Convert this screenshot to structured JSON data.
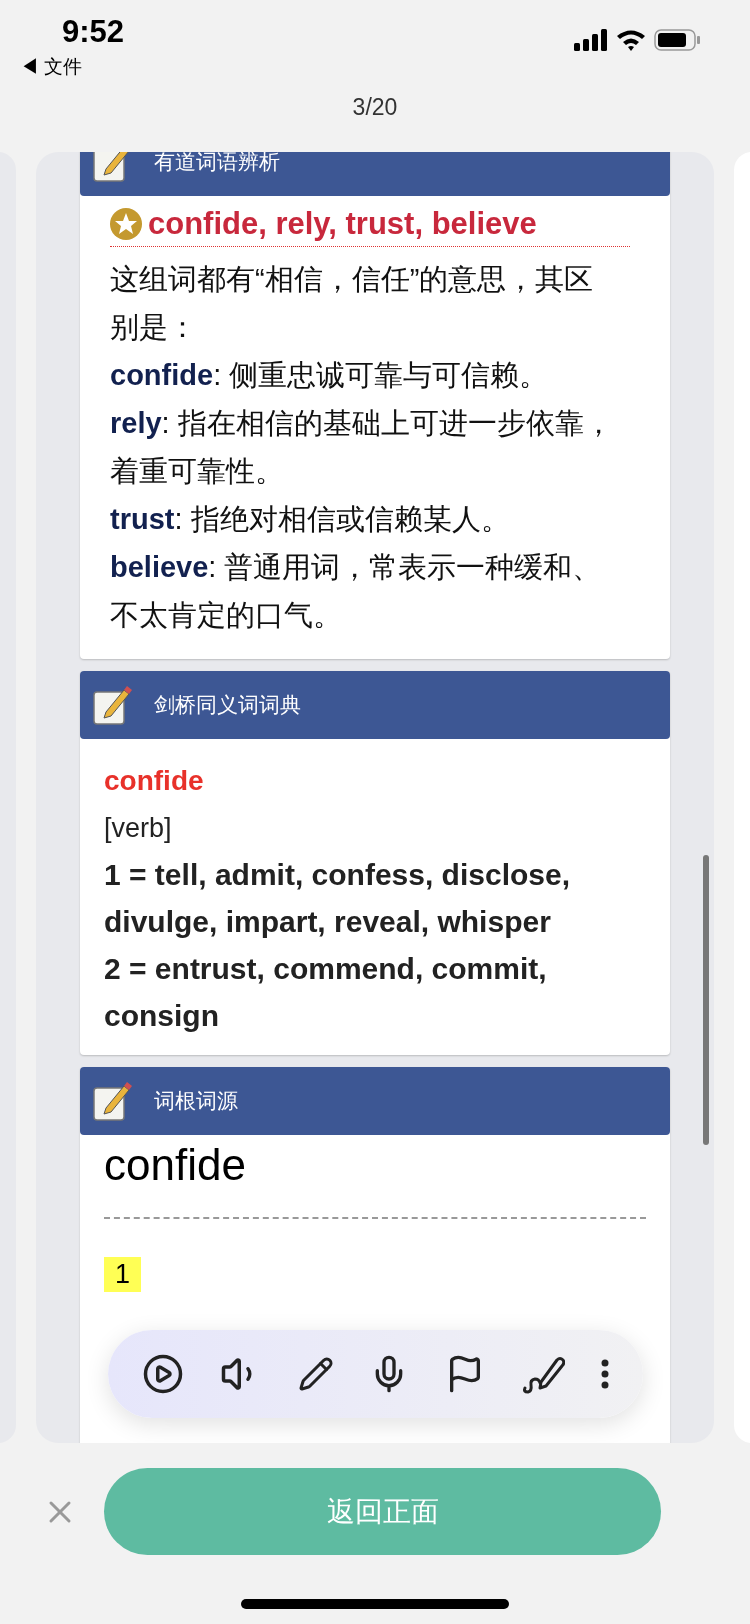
{
  "status_bar": {
    "time": "9:52",
    "back_arrow": "◀",
    "back_label": "文件"
  },
  "page_counter": "3/20",
  "sections": [
    {
      "kind": "analysis",
      "title": "有道词语辨析",
      "heading": "confide, rely, trust, believe",
      "intro": "这组词都有“相信，信任”的意思，其区别是：",
      "entries": [
        {
          "term": "confide",
          "definition": ": 侧重忠诚可靠与可信赖。"
        },
        {
          "term": "rely",
          "definition": ": 指在相信的基础上可进一步依靠，着重可靠性。"
        },
        {
          "term": "trust",
          "definition": ": 指绝对相信或信赖某人。"
        },
        {
          "term": "believe",
          "definition": ": 普通用词，常表示一种缓和、不太肯定的口气。"
        }
      ]
    },
    {
      "kind": "thesaurus",
      "title": "剑桥同义词词典",
      "headword": "confide",
      "pos": "[verb]",
      "senses": [
        "1 = tell, admit, confess, disclose, divulge, impart, reveal, whisper",
        "2 = entrust, commend, commit, consign"
      ]
    },
    {
      "kind": "etymology",
      "title": "词根词源",
      "headword": "confide",
      "number": "1"
    }
  ],
  "bottom_bar": {
    "button": "返回正面"
  }
}
